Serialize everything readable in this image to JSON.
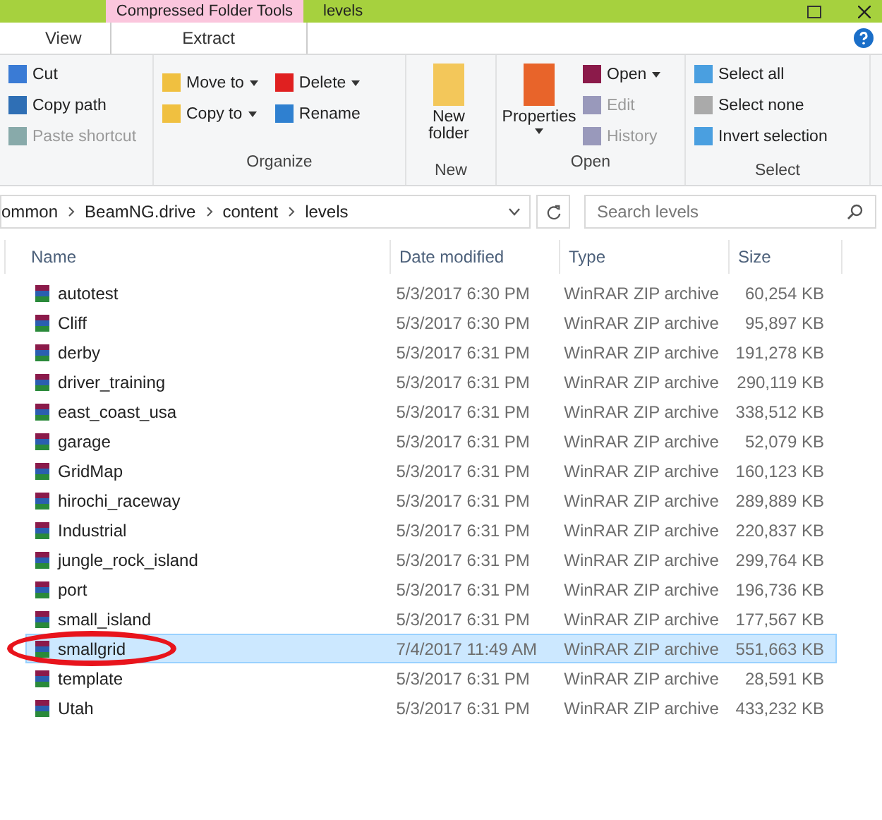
{
  "title_bar": {
    "context_tab": "Compressed Folder Tools",
    "title": "levels"
  },
  "tabs": [
    {
      "label": "View",
      "selected": false
    },
    {
      "label": "Extract",
      "selected": true
    }
  ],
  "ribbon": {
    "groups": [
      {
        "items": [
          {
            "label": "Cut",
            "kind": "small",
            "disabled": false
          },
          {
            "label": "Copy path",
            "kind": "small",
            "disabled": false
          },
          {
            "label": "Paste shortcut",
            "kind": "small",
            "disabled": true
          }
        ]
      },
      {
        "label": "Organize",
        "items": [
          {
            "label": "Move to",
            "kind": "small",
            "disabled": false,
            "dropdown": true
          },
          {
            "label": "Copy to",
            "kind": "small",
            "disabled": false,
            "dropdown": true
          },
          {
            "label": "Delete",
            "kind": "small",
            "disabled": false,
            "dropdown": true
          },
          {
            "label": "Rename",
            "kind": "small",
            "disabled": false,
            "dropdown": false
          }
        ]
      },
      {
        "label": "New",
        "items": [
          {
            "label": "New folder",
            "kind": "large",
            "disabled": false
          }
        ]
      },
      {
        "label": "Open",
        "items": [
          {
            "label": "Properties",
            "kind": "large",
            "disabled": false,
            "dropdown": true
          },
          {
            "label": "Open",
            "kind": "small",
            "disabled": false,
            "dropdown": true
          },
          {
            "label": "Edit",
            "kind": "small",
            "disabled": true
          },
          {
            "label": "History",
            "kind": "small",
            "disabled": true
          }
        ]
      },
      {
        "label": "Select",
        "items": [
          {
            "label": "Select all",
            "kind": "small",
            "disabled": false
          },
          {
            "label": "Select none",
            "kind": "small",
            "disabled": false
          },
          {
            "label": "Invert selection",
            "kind": "small",
            "disabled": false
          }
        ]
      }
    ]
  },
  "breadcrumb": [
    "ommon",
    "BeamNG.drive",
    "content",
    "levels"
  ],
  "search": {
    "placeholder": "Search levels"
  },
  "table": {
    "columns": [
      "Name",
      "Date modified",
      "Type",
      "Size"
    ],
    "rows": [
      {
        "name": "autotest",
        "date": "5/3/2017 6:30 PM",
        "type": "WinRAR ZIP archive",
        "size": "60,254 KB",
        "selected": false
      },
      {
        "name": "Cliff",
        "date": "5/3/2017 6:30 PM",
        "type": "WinRAR ZIP archive",
        "size": "95,897 KB",
        "selected": false
      },
      {
        "name": "derby",
        "date": "5/3/2017 6:31 PM",
        "type": "WinRAR ZIP archive",
        "size": "191,278 KB",
        "selected": false
      },
      {
        "name": "driver_training",
        "date": "5/3/2017 6:31 PM",
        "type": "WinRAR ZIP archive",
        "size": "290,119 KB",
        "selected": false
      },
      {
        "name": "east_coast_usa",
        "date": "5/3/2017 6:31 PM",
        "type": "WinRAR ZIP archive",
        "size": "338,512 KB",
        "selected": false
      },
      {
        "name": "garage",
        "date": "5/3/2017 6:31 PM",
        "type": "WinRAR ZIP archive",
        "size": "52,079 KB",
        "selected": false
      },
      {
        "name": "GridMap",
        "date": "5/3/2017 6:31 PM",
        "type": "WinRAR ZIP archive",
        "size": "160,123 KB",
        "selected": false
      },
      {
        "name": "hirochi_raceway",
        "date": "5/3/2017 6:31 PM",
        "type": "WinRAR ZIP archive",
        "size": "289,889 KB",
        "selected": false
      },
      {
        "name": "Industrial",
        "date": "5/3/2017 6:31 PM",
        "type": "WinRAR ZIP archive",
        "size": "220,837 KB",
        "selected": false
      },
      {
        "name": "jungle_rock_island",
        "date": "5/3/2017 6:31 PM",
        "type": "WinRAR ZIP archive",
        "size": "299,764 KB",
        "selected": false
      },
      {
        "name": "port",
        "date": "5/3/2017 6:31 PM",
        "type": "WinRAR ZIP archive",
        "size": "196,736 KB",
        "selected": false
      },
      {
        "name": "small_island",
        "date": "5/3/2017 6:31 PM",
        "type": "WinRAR ZIP archive",
        "size": "177,567 KB",
        "selected": false
      },
      {
        "name": "smallgrid",
        "date": "7/4/2017 11:49 AM",
        "type": "WinRAR ZIP archive",
        "size": "551,663 KB",
        "selected": true,
        "circled": true
      },
      {
        "name": "template",
        "date": "5/3/2017 6:31 PM",
        "type": "WinRAR ZIP archive",
        "size": "28,591 KB",
        "selected": false
      },
      {
        "name": "Utah",
        "date": "5/3/2017 6:31 PM",
        "type": "WinRAR ZIP archive",
        "size": "433,232 KB",
        "selected": false
      }
    ]
  }
}
